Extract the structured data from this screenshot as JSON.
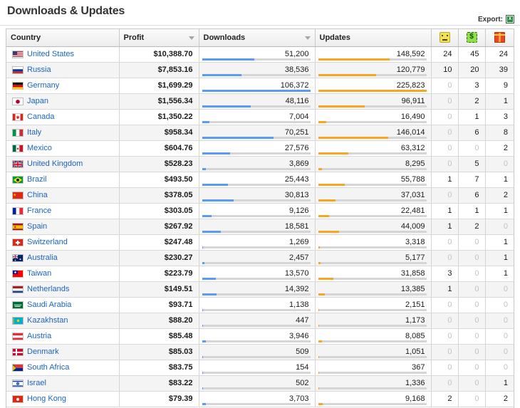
{
  "header": {
    "title": "Downloads & Updates",
    "export_label": "Export:",
    "export_icon": "excel-export-icon"
  },
  "table": {
    "columns": [
      {
        "key": "country",
        "label": "Country",
        "sortable": false,
        "sort_indicator": false
      },
      {
        "key": "profit",
        "label": "Profit",
        "sortable": true,
        "sort_indicator": true
      },
      {
        "key": "downloads",
        "label": "Downloads",
        "sortable": true,
        "sort_indicator": true
      },
      {
        "key": "updates",
        "label": "Updates",
        "sortable": false,
        "sort_indicator": false
      },
      {
        "key": "faces",
        "label": "",
        "icon": "yellow-face-icon",
        "sortable": true,
        "sort_indicator": false
      },
      {
        "key": "money",
        "label": "",
        "icon": "green-money-icon",
        "sortable": true,
        "sort_indicator": false
      },
      {
        "key": "gifts",
        "label": "",
        "icon": "red-gift-icon",
        "sortable": true,
        "sort_indicator": false
      }
    ],
    "colors": {
      "downloads_bar": "#5b9bf0",
      "updates_bar": "#f5a623",
      "bar_track": "#d5d5d5",
      "link": "#1a64c8",
      "zero_value": "#c2c2c2"
    },
    "scale": {
      "downloads_max": 106372,
      "updates_max": 225823
    },
    "rows": [
      {
        "country": "United States",
        "flag": "flag-us",
        "profit": "$10,388.70",
        "downloads": "51,200",
        "downloads_num": 51200,
        "updates": "148,592",
        "updates_num": 148592,
        "faces": "24",
        "money": "45",
        "gifts": "24"
      },
      {
        "country": "Russia",
        "flag": "flag-ru",
        "profit": "$7,853.16",
        "downloads": "38,536",
        "downloads_num": 38536,
        "updates": "120,779",
        "updates_num": 120779,
        "faces": "10",
        "money": "20",
        "gifts": "39"
      },
      {
        "country": "Germany",
        "flag": "flag-de",
        "profit": "$1,699.29",
        "downloads": "106,372",
        "downloads_num": 106372,
        "updates": "225,823",
        "updates_num": 225823,
        "faces": "0",
        "money": "3",
        "gifts": "9"
      },
      {
        "country": "Japan",
        "flag": "flag-jp",
        "profit": "$1,556.34",
        "downloads": "48,116",
        "downloads_num": 48116,
        "updates": "96,911",
        "updates_num": 96911,
        "faces": "0",
        "money": "2",
        "gifts": "1"
      },
      {
        "country": "Canada",
        "flag": "flag-ca",
        "profit": "$1,350.22",
        "downloads": "7,004",
        "downloads_num": 7004,
        "updates": "16,490",
        "updates_num": 16490,
        "faces": "0",
        "money": "1",
        "gifts": "3"
      },
      {
        "country": "Italy",
        "flag": "flag-it",
        "profit": "$958.34",
        "downloads": "70,251",
        "downloads_num": 70251,
        "updates": "146,014",
        "updates_num": 146014,
        "faces": "0",
        "money": "6",
        "gifts": "8"
      },
      {
        "country": "Mexico",
        "flag": "flag-mx",
        "profit": "$604.76",
        "downloads": "27,576",
        "downloads_num": 27576,
        "updates": "63,312",
        "updates_num": 63312,
        "faces": "0",
        "money": "0",
        "gifts": "2"
      },
      {
        "country": "United Kingdom",
        "flag": "flag-gb",
        "profit": "$528.23",
        "downloads": "3,869",
        "downloads_num": 3869,
        "updates": "8,295",
        "updates_num": 8295,
        "faces": "0",
        "money": "5",
        "gifts": "0"
      },
      {
        "country": "Brazil",
        "flag": "flag-br",
        "profit": "$493.50",
        "downloads": "25,443",
        "downloads_num": 25443,
        "updates": "55,788",
        "updates_num": 55788,
        "faces": "1",
        "money": "7",
        "gifts": "1"
      },
      {
        "country": "China",
        "flag": "flag-cn",
        "profit": "$378.05",
        "downloads": "30,813",
        "downloads_num": 30813,
        "updates": "37,031",
        "updates_num": 37031,
        "faces": "0",
        "money": "6",
        "gifts": "2"
      },
      {
        "country": "France",
        "flag": "flag-fr",
        "profit": "$303.05",
        "downloads": "9,126",
        "downloads_num": 9126,
        "updates": "22,481",
        "updates_num": 22481,
        "faces": "1",
        "money": "1",
        "gifts": "1"
      },
      {
        "country": "Spain",
        "flag": "flag-es",
        "profit": "$267.92",
        "downloads": "18,581",
        "downloads_num": 18581,
        "updates": "44,009",
        "updates_num": 44009,
        "faces": "1",
        "money": "2",
        "gifts": "0"
      },
      {
        "country": "Switzerland",
        "flag": "flag-ch",
        "profit": "$247.48",
        "downloads": "1,269",
        "downloads_num": 1269,
        "updates": "3,318",
        "updates_num": 3318,
        "faces": "0",
        "money": "0",
        "gifts": "1"
      },
      {
        "country": "Australia",
        "flag": "flag-au",
        "profit": "$230.27",
        "downloads": "2,457",
        "downloads_num": 2457,
        "updates": "5,177",
        "updates_num": 5177,
        "faces": "0",
        "money": "0",
        "gifts": "1"
      },
      {
        "country": "Taiwan",
        "flag": "flag-tw",
        "profit": "$223.79",
        "downloads": "13,570",
        "downloads_num": 13570,
        "updates": "31,858",
        "updates_num": 31858,
        "faces": "3",
        "money": "0",
        "gifts": "1"
      },
      {
        "country": "Netherlands",
        "flag": "flag-nl",
        "profit": "$149.51",
        "downloads": "14,392",
        "downloads_num": 14392,
        "updates": "13,385",
        "updates_num": 13385,
        "faces": "1",
        "money": "0",
        "gifts": "0"
      },
      {
        "country": "Saudi Arabia",
        "flag": "flag-sa",
        "profit": "$93.71",
        "downloads": "1,138",
        "downloads_num": 1138,
        "updates": "2,151",
        "updates_num": 2151,
        "faces": "0",
        "money": "0",
        "gifts": "0"
      },
      {
        "country": "Kazakhstan",
        "flag": "flag-kz",
        "profit": "$88.20",
        "downloads": "447",
        "downloads_num": 447,
        "updates": "1,173",
        "updates_num": 1173,
        "faces": "0",
        "money": "0",
        "gifts": "0"
      },
      {
        "country": "Austria",
        "flag": "flag-at",
        "profit": "$85.48",
        "downloads": "3,946",
        "downloads_num": 3946,
        "updates": "8,085",
        "updates_num": 8085,
        "faces": "0",
        "money": "0",
        "gifts": "0"
      },
      {
        "country": "Denmark",
        "flag": "flag-dk",
        "profit": "$85.03",
        "downloads": "509",
        "downloads_num": 509,
        "updates": "1,051",
        "updates_num": 1051,
        "faces": "0",
        "money": "0",
        "gifts": "0"
      },
      {
        "country": "South Africa",
        "flag": "flag-za",
        "profit": "$83.75",
        "downloads": "154",
        "downloads_num": 154,
        "updates": "367",
        "updates_num": 367,
        "faces": "0",
        "money": "0",
        "gifts": "0"
      },
      {
        "country": "Israel",
        "flag": "flag-il",
        "profit": "$83.22",
        "downloads": "502",
        "downloads_num": 502,
        "updates": "1,336",
        "updates_num": 1336,
        "faces": "0",
        "money": "0",
        "gifts": "1"
      },
      {
        "country": "Hong Kong",
        "flag": "flag-hk",
        "profit": "$79.39",
        "downloads": "3,703",
        "downloads_num": 3703,
        "updates": "9,168",
        "updates_num": 9168,
        "faces": "2",
        "money": "0",
        "gifts": "2"
      }
    ]
  }
}
